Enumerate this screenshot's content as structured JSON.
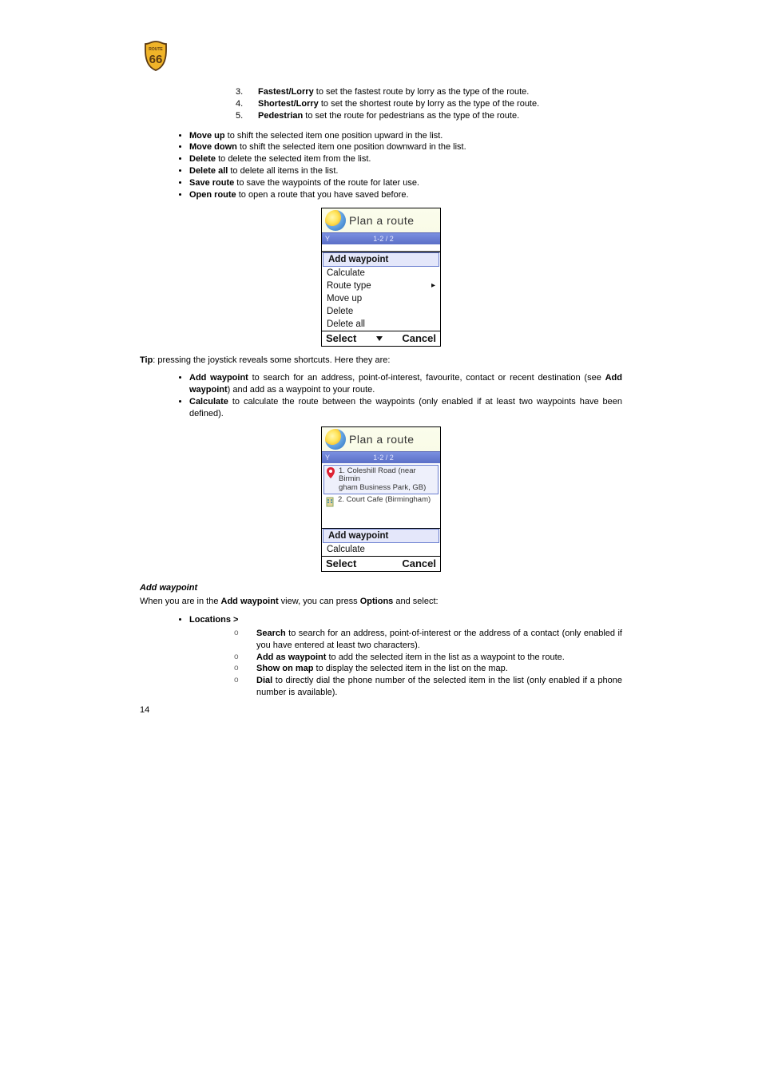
{
  "logo": {
    "top_text": "ROUTE",
    "num": "66"
  },
  "numbered_start": 3,
  "numbered": [
    {
      "bold": "Fastest/Lorry",
      "rest": " to set the fastest route by lorry as the type of the route."
    },
    {
      "bold": "Shortest/Lorry",
      "rest": " to set the shortest route by lorry as the type of the route."
    },
    {
      "bold": "Pedestrian",
      "rest": " to set the route for pedestrians as the type of the route."
    }
  ],
  "bullets1": [
    {
      "bold": "Move up",
      "rest": " to shift the selected item one position upward in the list."
    },
    {
      "bold": "Move down",
      "rest": " to shift the selected item one position downward in the list."
    },
    {
      "bold": "Delete",
      "rest": " to delete the selected item from the list."
    },
    {
      "bold": "Delete all",
      "rest": " to delete all items in the list."
    },
    {
      "bold": "Save route",
      "rest": " to save the waypoints of the route for later use."
    },
    {
      "bold": "Open route",
      "rest": " to open a route that you have saved before."
    }
  ],
  "screen1": {
    "title": "Plan a route",
    "counter": "1-2 / 2",
    "menu": [
      "Add waypoint",
      "Calculate",
      "Route type",
      "Move up",
      "Delete",
      "Delete all"
    ],
    "submenu_index": 2,
    "left": "Select",
    "right": "Cancel"
  },
  "tip_label": "Tip",
  "tip_text": ": pressing the joystick reveals some shortcuts. Here they are:",
  "bullets2": [
    {
      "bold": "Add waypoint",
      "rest": " to search for an address, point-of-interest, favourite, contact or recent destination (see ",
      "bold2": "Add waypoint",
      "rest2": ") and add as a waypoint to your route."
    },
    {
      "bold": "Calculate",
      "rest": " to calculate the route between the waypoints (only enabled if at least two waypoints have been defined)."
    }
  ],
  "screen2": {
    "title": "Plan a route",
    "counter": "1-2 / 2",
    "wp1_num": "1.",
    "wp1_line1": "Coleshill Road (near Birmin",
    "wp1_line2": "gham Business Park, GB)",
    "wp2_num": "2.",
    "wp2_text": "Court Cafe (Birmingham)",
    "menu": [
      "Add waypoint",
      "Calculate"
    ],
    "left": "Select",
    "right": "Cancel"
  },
  "section_heading": "Add waypoint",
  "section_intro_pre": "When you are in the ",
  "section_intro_bold1": "Add waypoint",
  "section_intro_mid": " view, you can press ",
  "section_intro_bold2": "Options",
  "section_intro_post": " and select:",
  "bullets3_header_bold": "Locations >",
  "bullets3_sub": [
    {
      "bold": "Search",
      "rest": " to search for an address, point-of-interest or the address of a contact (only enabled if you have entered at least two characters)."
    },
    {
      "bold": "Add as waypoint",
      "rest": " to add the selected item in the list as a waypoint to the route."
    },
    {
      "bold": "Show on map",
      "rest": " to display the selected item in the list on the map."
    },
    {
      "bold": "Dial",
      "rest": " to directly dial the phone number of the selected item in the list (only enabled if a phone number is available)."
    }
  ],
  "page_number": "14"
}
